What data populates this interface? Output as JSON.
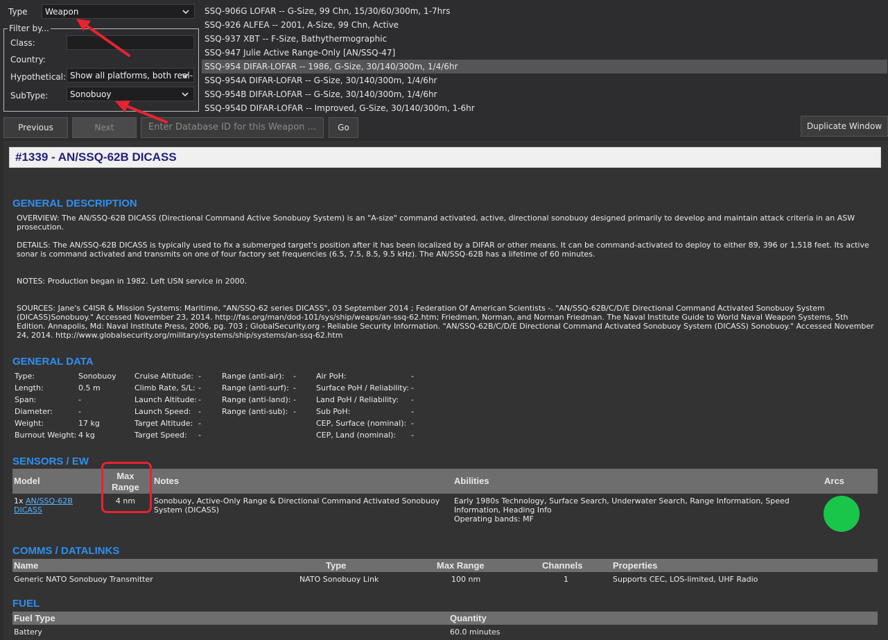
{
  "filters": {
    "type_label": "Type",
    "type_value": "Weapon",
    "filter_by_title": "Filter by...",
    "class_label": "Class:",
    "country_label": "Country:",
    "hypothetical_label": "Hypothetical:",
    "hypothetical_value": "Show all platforms, both real-l",
    "subtype_label": "SubType:",
    "subtype_value": "Sonobuoy"
  },
  "list": {
    "items": [
      "SSQ-906G LOFAR -- G-Size, 99 Chn, 15/30/60/300m, 1-7hrs",
      "SSQ-926 ALFEA -- 2001, A-Size, 99 Chn, Active",
      "SSQ-937 XBT -- F-Size, Bathythermographic",
      "SSQ-947 Julie Active Range-Only [AN/SSQ-47]",
      "SSQ-954 DIFAR-LOFAR -- 1986, G-Size, 30/140/300m, 1/4/6hr",
      "SSQ-954A DIFAR-LOFAR -- G-Size, 30/140/300m, 1/4/6hr",
      "SSQ-954B DIFAR-LOFAR -- G-Size, 30/140/300m, 1/4/6hr",
      "SSQ-954D DIFAR-LOFAR -- Improved, G-Size, 30/140/300m, 1-6hr"
    ],
    "selected_index": 4
  },
  "nav": {
    "previous": "Previous",
    "next": "Next",
    "db_placeholder": "Enter Database ID for this Weapon ...",
    "go": "Go",
    "duplicate": "Duplicate Window"
  },
  "record": {
    "title": "#1339 - AN/SSQ-62B DICASS"
  },
  "general_description": {
    "heading": "GENERAL DESCRIPTION",
    "overview": "OVERVIEW: The AN/SSQ-62B DICASS (Directional Command Active Sonobuoy System) is an \"A-size\" command activated, active, directional sonobuoy designed primarily to develop and maintain attack criteria in an ASW prosecution.",
    "details": "DETAILS: The AN/SSQ-62B DICASS is typically used to fix a submerged target's position after it has been localized by a DIFAR or other means. It can be command-activated to deploy to either 89, 396 or 1,518 feet. Its active sonar is command activated and transmits on one of four factory set frequencies (6.5, 7.5, 8.5, 9.5 kHz). The AN/SSQ-62B has a lifetime of 60 minutes.",
    "notes": "NOTES: Production began in 1982. Left USN service in 2000.",
    "sources": "SOURCES: Jane's C4ISR & Mission Systems: Maritime, \"AN/SSQ-62 series DICASS\", 03 September 2014 ; Federation Of American Scientists -. \"AN/SSQ-62B/C/D/E Directional Command Activated Sonobuoy System (DICASS)Sonobuoy.\" Accessed November 23, 2014. http://fas.org/man/dod-101/sys/ship/weaps/an-ssq-62.htm; Friedman, Norman, and Norman Friedman. The Naval Institute Guide to World Naval Weapon Systems, 5th Edition. Annapolis, Md: Naval Institute Press, 2006, pg. 703 ; GlobalSecurity.org - Reliable Security Information. \"AN/SSQ-62B/C/D/E Directional Command Activated Sonobuoy System (DICASS) Sonobuoy.\" Accessed November 24, 2014. http://www.globalsecurity.org/military/systems/ship/systems/an-ssq-62.htm"
  },
  "general_data": {
    "heading": "GENERAL DATA",
    "col1": [
      {
        "label": "Type:",
        "value": "Sonobuoy"
      },
      {
        "label": "Length:",
        "value": "0.5 m"
      },
      {
        "label": "Span:",
        "value": "-"
      },
      {
        "label": "Diameter:",
        "value": "-"
      },
      {
        "label": "Weight:",
        "value": "17 kg"
      },
      {
        "label": "Burnout Weight:",
        "value": "4 kg"
      }
    ],
    "col2": [
      {
        "label": "Cruise Altitude:",
        "value": "-"
      },
      {
        "label": "Climb Rate, S/L:",
        "value": "-"
      },
      {
        "label": "Launch Altitude:",
        "value": "-"
      },
      {
        "label": "Launch Speed:",
        "value": "-"
      },
      {
        "label": "Target Altitude:",
        "value": "-"
      },
      {
        "label": "Target Speed:",
        "value": "-"
      }
    ],
    "col3": [
      {
        "label": "Range (anti-air):",
        "value": "-"
      },
      {
        "label": "Range (anti-surf):",
        "value": "-"
      },
      {
        "label": "Range (anti-land):",
        "value": "-"
      },
      {
        "label": "Range (anti-sub):",
        "value": "-"
      }
    ],
    "col4": [
      {
        "label": "Air PoH:",
        "value": "-"
      },
      {
        "label": "Surface PoH / Reliability:",
        "value": "-"
      },
      {
        "label": "Land PoH / Reliability:",
        "value": "-"
      },
      {
        "label": "Sub PoH:",
        "value": "-"
      },
      {
        "label": "CEP, Surface (nominal):",
        "value": "-"
      },
      {
        "label": "CEP, Land (nominal):",
        "value": "-"
      }
    ]
  },
  "sensors": {
    "heading": "SENSORS / EW",
    "headers": {
      "model": "Model",
      "max_range_1": "Max",
      "max_range_2": "Range",
      "notes": "Notes",
      "abilities": "Abilities",
      "arcs": "Arcs"
    },
    "row": {
      "qty": "1x ",
      "model_line1": "AN/SSQ-62B",
      "model_line2": "DICASS",
      "max_range": "4 nm",
      "notes": "Sonobuoy, Active-Only Range & Directional Command Activated Sonobuoy System (DICASS)",
      "abilities": "Early 1980s Technology, Surface Search, Underwater Search, Range Information, Speed Information, Heading Info",
      "bands": "Operating bands: MF",
      "arc_color": "#19c64a"
    }
  },
  "comms": {
    "heading": "COMMS / DATALINKS",
    "headers": {
      "name": "Name",
      "type": "Type",
      "max_range": "Max Range",
      "channels": "Channels",
      "properties": "Properties"
    },
    "row": {
      "name": "Generic NATO Sonobuoy Transmitter",
      "type": "NATO Sonobuoy Link",
      "max_range": "100 nm",
      "channels": "1",
      "properties": "Supports CEC, LOS-limited, UHF Radio"
    }
  },
  "fuel": {
    "heading": "FUEL",
    "headers": {
      "fuel_type": "Fuel Type",
      "quantity": "Quantity"
    },
    "row": {
      "fuel_type": "Battery",
      "quantity": "60.0 minutes"
    }
  },
  "colors": {
    "accent": "#2f8ff0",
    "highlight": "#e8232f",
    "title_text": "#1f1f7a"
  }
}
